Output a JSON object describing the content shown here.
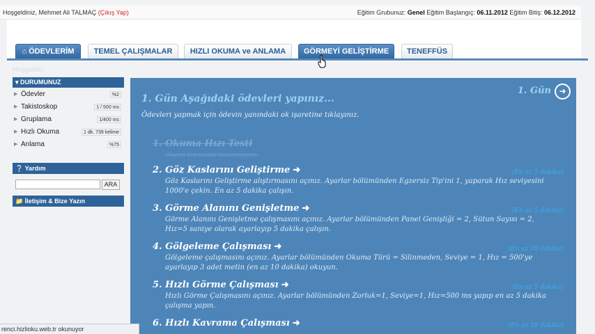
{
  "topbar": {
    "welcome": "Hoşgeldiniz, Mehmet Ali TALMAÇ",
    "logout": "(Çıkış Yap)",
    "group_label": "Eğitim Grubunuz:",
    "group_value": "Genel",
    "start_label": "Eğitim Başlangıç:",
    "start_value": "06.11.2012",
    "end_label": "Eğitim Bitiş:",
    "end_value": "06.12.2012"
  },
  "tabs": [
    {
      "label": "ÖDEVLERİM",
      "active": true
    },
    {
      "label": "TEMEL ÇALIŞMALAR",
      "active": false
    },
    {
      "label": "HIZLI OKUMA ve ANLAMA",
      "active": false
    },
    {
      "label": "GÖRMEYİ GELİŞTİRME",
      "active": false
    },
    {
      "label": "TENEFFÜS",
      "active": false
    }
  ],
  "breadcrumb": "Hoşgeldin",
  "status_box": {
    "title": "DURUMUNUZ",
    "items": [
      {
        "label": "Ödevler",
        "value": "%2"
      },
      {
        "label": "Takistoskop",
        "value": "1 / 500 ms"
      },
      {
        "label": "Gruplama",
        "value": "1/400 ms"
      },
      {
        "label": "Hızlı Okuma",
        "value": "1 dk. 739 kelime"
      },
      {
        "label": "Anlama",
        "value": "%75"
      }
    ]
  },
  "help_box": {
    "title": "Yardım",
    "search_button": "ARA"
  },
  "contact_box": {
    "title": "İletişim & Bize Yazın"
  },
  "content": {
    "title": "1. Gün Aşağıdaki ödevleri yapınız...",
    "day_label": "1. Gün",
    "intro": "Ödevleri yapmak için ödevin yanındaki ok işaretine tıklayınız.",
    "tasks": [
      {
        "num": "1.",
        "title": "Okuma Hızı Testi",
        "desc": "Okuma hızı testini tamamlayınız.",
        "duration": "",
        "done": true
      },
      {
        "num": "2.",
        "title": "Göz Kaslarını Geliştirme",
        "desc": "Göz Kaslarını Geliştirme alıştırmasını açınız. Ayarlar bölümünden Egzersiz Tip'ini 1, yaparak Hız seviyesini 1000'e çekin. En az 5 dakika çalışın.",
        "duration": "(En az 5 dakika)",
        "done": false
      },
      {
        "num": "3.",
        "title": "Görme Alanını Genişletme",
        "desc": "Görme Alanını Genişletme çalışmasını açınız. Ayarlar bölümünden Panel Genişliği = 2, Sütun Sayısı = 2, Hız=5 saniye olarak ayarlayıp 5 dakika çalışın.",
        "duration": "(En az 5 dakika)",
        "done": false
      },
      {
        "num": "4.",
        "title": "Gölgeleme Çalışması",
        "desc": "Gölgeleme çalışmasını açınız. Ayarlar bölümünden Okuma Türü = Silinmeden, Seviye = 1, Hız = 500'ye ayarlayıp 3 adet metin (en az 10 dakika) okuyun.",
        "duration": "(En az 10 dakika)",
        "done": false
      },
      {
        "num": "5.",
        "title": "Hızlı Görme Çalışması",
        "desc": "Hızlı Görme Çalışmasını açınız. Ayarlar bölümünden Zorluk=1, Seviye=1, Hız=500 ms yapıp en az 5 dakika çalışma yapın.",
        "duration": "(En az 5 dakika)",
        "done": false
      },
      {
        "num": "6.",
        "title": "Hızlı Kavrama Çalışması",
        "desc": "",
        "duration": "(En az 10 dakika)",
        "done": false
      }
    ]
  },
  "statusbar": "renci.hizlioku.web.tr okunuyor",
  "colors": {
    "accent": "#2e6399",
    "content_bg": "#4d85b9",
    "duration": "#36b0f0",
    "logout": "#dd2222"
  }
}
